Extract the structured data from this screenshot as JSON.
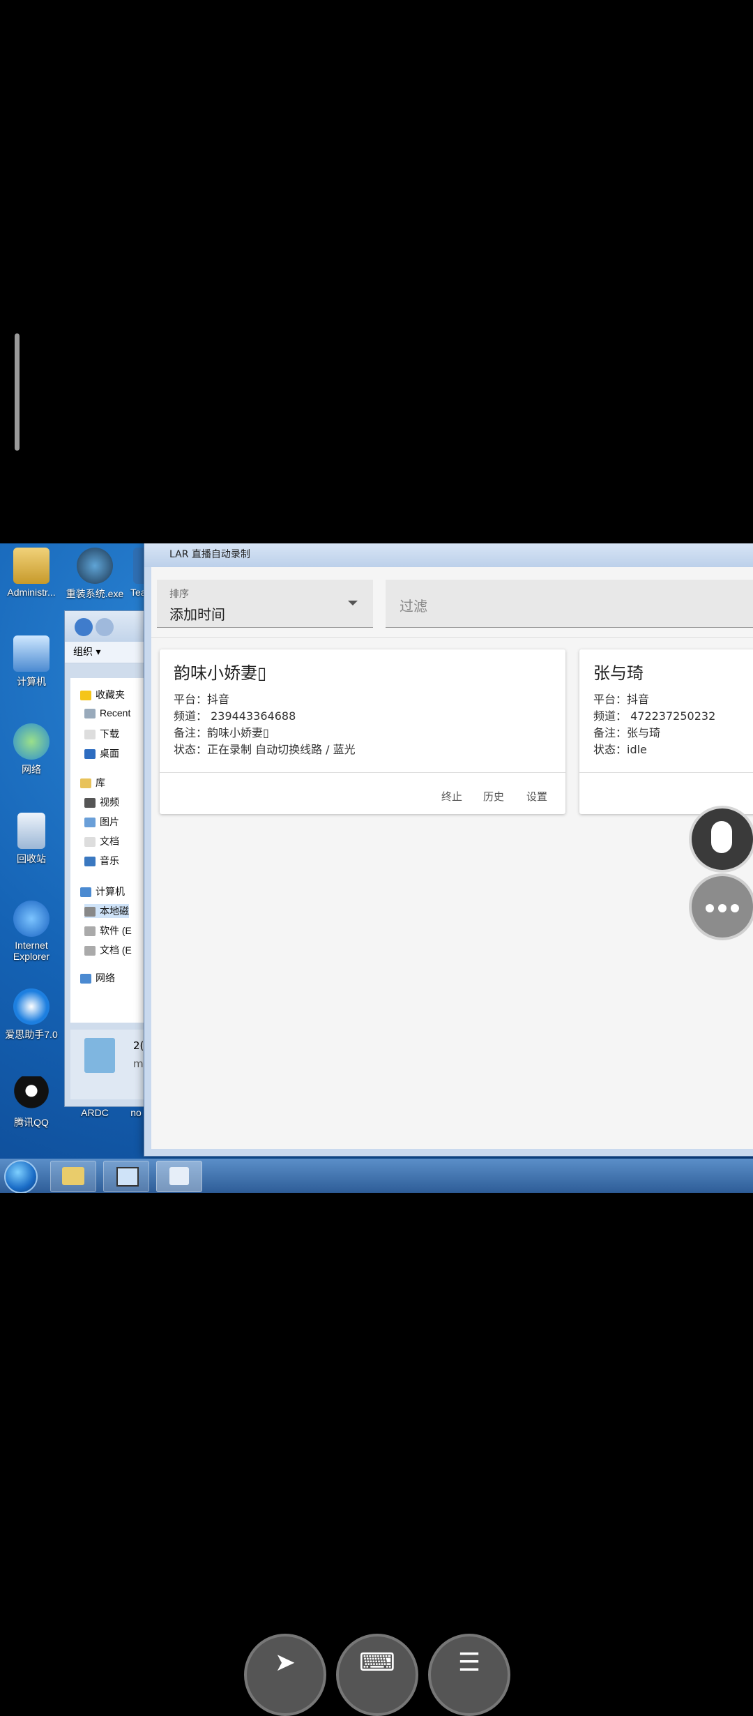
{
  "app": {
    "title": "LAR 直播自动录制",
    "sort": {
      "label": "排序",
      "value": "添加时间"
    },
    "filter": {
      "placeholder": "过滤"
    },
    "cards": [
      {
        "title": "韵味小娇妻▯",
        "platform": "平台：抖音",
        "channel": "频道： 239443364688",
        "remark": "备注：韵味小娇妻▯",
        "status": "状态：正在录制 自动切换线路 / 蓝光",
        "actions": [
          "终止",
          "历史",
          "设置"
        ]
      },
      {
        "title": "张与琦",
        "platform": "平台：抖音",
        "channel": "频道： 472237250232",
        "remark": "备注：张与琦",
        "status": "状态：idle"
      }
    ]
  },
  "desktop": {
    "icons": [
      "Administr...",
      "重装系统.exe",
      "Tea",
      "计算机",
      "网络",
      "回收站",
      "Internet Explorer",
      "爱思助手7.0",
      "腾讯QQ",
      "ARDC",
      "no"
    ]
  },
  "explorer": {
    "toolbar": "组织 ▾",
    "tree": [
      "收藏夹",
      "Recent",
      "下载",
      "桌面",
      "库",
      "视频",
      "图片",
      "文档",
      "音乐",
      "计算机",
      "本地磁",
      "软件 (E",
      "文档 (E",
      "网络"
    ],
    "status_partial": [
      "2(",
      "m"
    ]
  },
  "icons": {
    "mouse": "mouse-icon",
    "more": "more-horizontal-icon",
    "pointer": "pointer-icon",
    "keyboard": "keyboard-icon",
    "menu": "menu-icon"
  }
}
